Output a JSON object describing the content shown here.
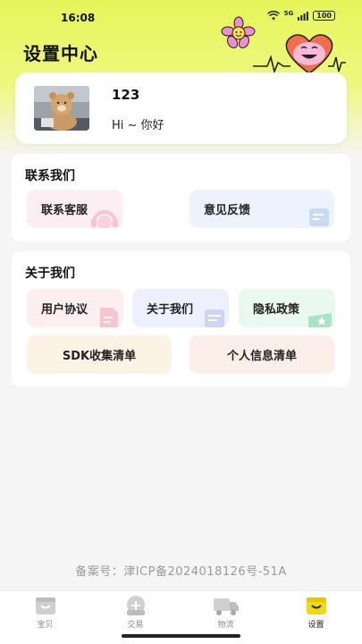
{
  "status_bar": {
    "time": "16:08",
    "signal_label": "5G",
    "battery": "100"
  },
  "header": {
    "title": "设置中心"
  },
  "profile": {
    "username": "123",
    "greeting": "Hi ~ 你好"
  },
  "contact_section": {
    "title": "联系我们",
    "items": [
      {
        "label": "联系客服",
        "icon": "headset-icon",
        "color": "#fdeef3"
      },
      {
        "label": "意见反馈",
        "icon": "feedback-icon",
        "color": "#edf3fd"
      }
    ]
  },
  "about_section": {
    "title": "关于我们",
    "items": [
      {
        "label": "用户协议",
        "icon": "document-icon",
        "color": "#fdeef2"
      },
      {
        "label": "关于我们",
        "icon": "info-doc-icon",
        "color": "#eef1fd"
      },
      {
        "label": "隐私政策",
        "icon": "star-card-icon",
        "color": "#eaf8f2"
      },
      {
        "label": "SDK收集清单",
        "color": "#fdf3e4"
      },
      {
        "label": "个人信息清单",
        "color": "#fcefea"
      }
    ]
  },
  "footer": {
    "icp": "备案号：津ICP备2024018126号-51A"
  },
  "tab_bar": {
    "tabs": [
      {
        "label": "宝贝",
        "icon": "treasure-icon",
        "active": false
      },
      {
        "label": "交易",
        "icon": "exchange-icon",
        "active": false
      },
      {
        "label": "物流",
        "icon": "truck-icon",
        "active": false
      },
      {
        "label": "设置",
        "icon": "settings-bag-icon",
        "active": true
      }
    ],
    "active_color": "#f2d916"
  }
}
